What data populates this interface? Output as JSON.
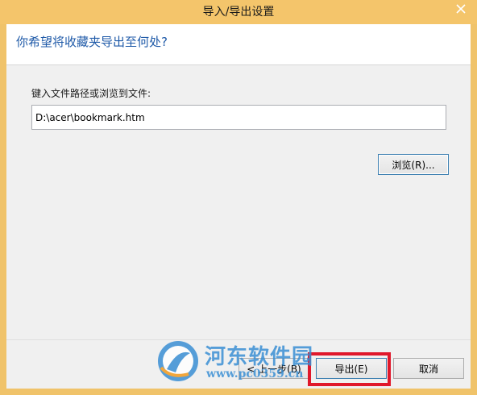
{
  "window": {
    "title": "导入/导出设置",
    "close_glyph": "✕"
  },
  "header": {
    "question": "你希望将收藏夹导出至何处?"
  },
  "form": {
    "path_label": "键入文件路径或浏览到文件:",
    "path_value": "D:\\acer\\bookmark.htm",
    "browse_label": "浏览(R)..."
  },
  "footer": {
    "back_label": "< 上一步(B)",
    "export_label": "导出(E)",
    "cancel_label": "取消"
  },
  "watermark": {
    "brand": "河东软件园",
    "url": "www.pc0359.cn"
  },
  "colors": {
    "title_bar": "#f4c56b",
    "accent_text": "#1f5aa8",
    "highlight": "#e0182b",
    "close_button": "#c75050"
  },
  "icons": {
    "close": "close-icon",
    "watermark_logo": "watermark-logo-icon"
  }
}
